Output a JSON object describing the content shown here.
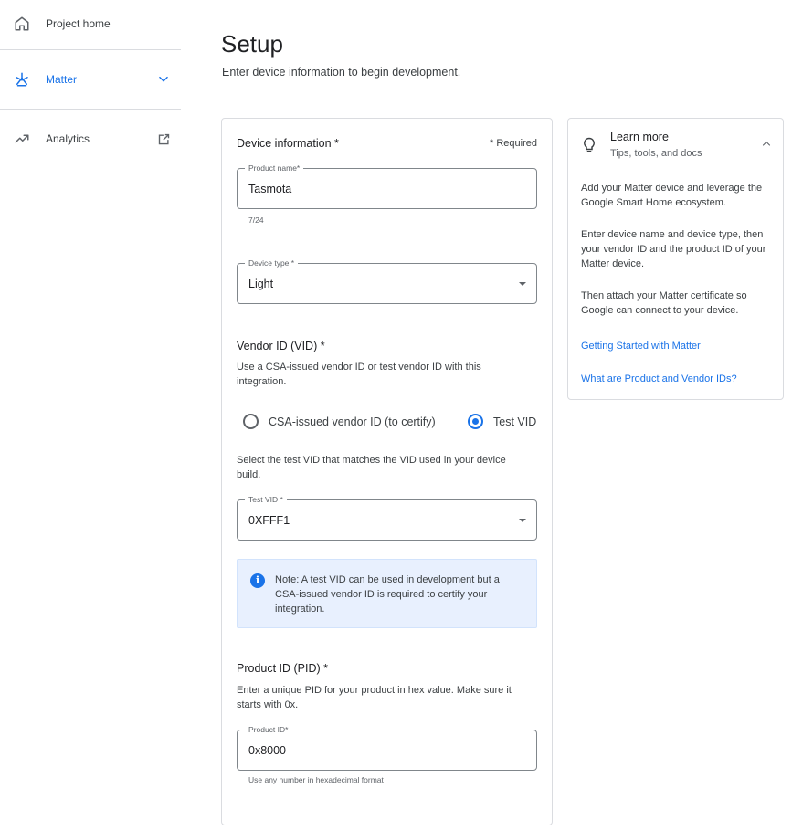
{
  "sidebar": {
    "items": [
      {
        "label": "Project home",
        "icon": "home-icon"
      },
      {
        "label": "Matter",
        "icon": "matter-icon"
      },
      {
        "label": "Analytics",
        "icon": "analytics-icon"
      }
    ]
  },
  "header": {
    "title": "Setup",
    "subtitle": "Enter device information to begin development."
  },
  "device_info": {
    "title": "Device information *",
    "required_note": "* Required",
    "product_name": {
      "label": "Product name*",
      "value": "Tasmota",
      "counter": "7/24"
    },
    "device_type": {
      "label": "Device type *",
      "value": "Light"
    }
  },
  "vendor": {
    "title": "Vendor ID (VID) *",
    "description": "Use a CSA-issued vendor ID or test vendor ID with this integration.",
    "options": [
      {
        "label": "CSA-issued vendor ID (to certify)",
        "selected": false
      },
      {
        "label": "Test VID",
        "selected": true
      }
    ],
    "test_description": "Select the test VID that matches the VID used in your device build.",
    "test_vid": {
      "label": "Test VID *",
      "value": "0XFFF1"
    },
    "note": "Note: A test VID can be used in development but a CSA-issued vendor ID is required to certify your integration."
  },
  "product": {
    "title": "Product ID (PID) *",
    "description": "Enter a unique PID for your product in hex value. Make sure it starts with 0x.",
    "pid": {
      "label": "Product ID*",
      "value": "0x8000",
      "hint": "Use any number in hexadecimal format"
    }
  },
  "learn_more": {
    "title": "Learn more",
    "subtitle": "Tips, tools, and docs",
    "paragraphs": [
      "Add your Matter device and leverage the Google Smart Home ecosystem.",
      "Enter device name and device type, then your vendor ID and the product ID of your Matter device.",
      "Then attach your Matter certificate so Google can connect to your device."
    ],
    "links": [
      "Getting Started with Matter",
      "What are Product and Vendor IDs?"
    ]
  },
  "colors": {
    "accent": "#1a73e8",
    "text": "#202124",
    "border": "#dadce0",
    "note_bg": "#e8f0fe"
  }
}
